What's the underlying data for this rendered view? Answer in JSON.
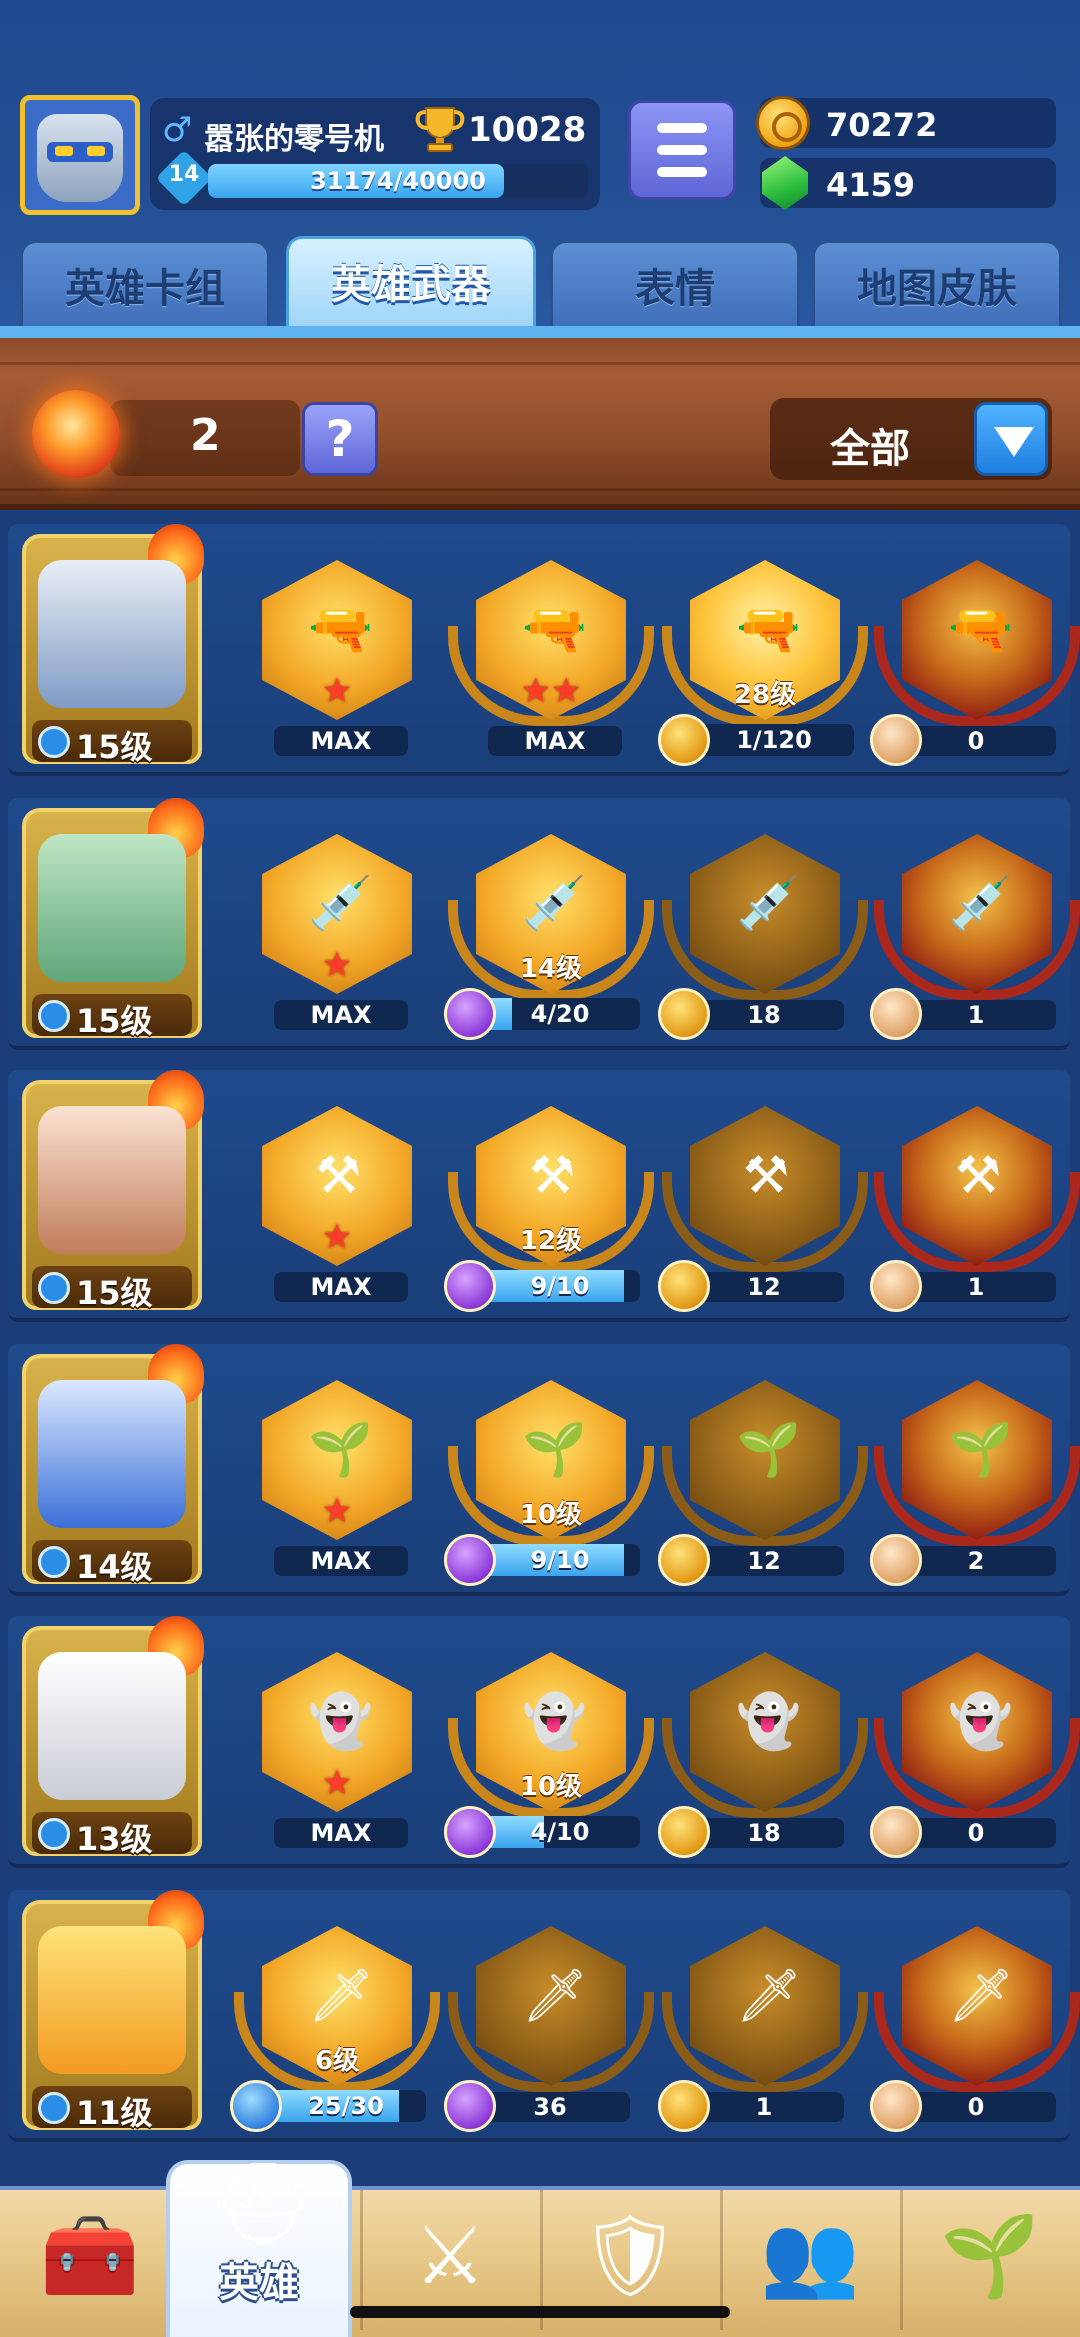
{
  "player": {
    "name": "嚣张的零号机",
    "trophies": "10028",
    "level": "14",
    "xp_text": "31174/40000",
    "xp_progress": 0.779
  },
  "currency": {
    "coins": "70272",
    "gems": "4159"
  },
  "tabs": [
    {
      "label": "英雄卡组",
      "active": false
    },
    {
      "label": "英雄武器",
      "active": true
    },
    {
      "label": "表情",
      "active": false
    },
    {
      "label": "地图皮肤",
      "active": false
    }
  ],
  "filter_bar": {
    "fireball_count": "2",
    "help_label": "?",
    "filter_value": "全部"
  },
  "heroes": [
    {
      "level": "15级",
      "class_icon": "blue-drop-icon",
      "portrait": "robot-hero",
      "slots": [
        {
          "label": "MAX",
          "stars": 1,
          "type": "max"
        },
        {
          "label": "MAX",
          "stars": 2,
          "type": "max"
        },
        {
          "level": "28级",
          "progress_text": "1/120",
          "material": "coin",
          "type": "progress-plain"
        },
        {
          "count": "0",
          "material": "hero",
          "type": "locked"
        }
      ]
    },
    {
      "level": "15级",
      "class_icon": "blue-swirl-icon",
      "portrait": "zombie-hero",
      "slots": [
        {
          "label": "MAX",
          "stars": 1,
          "type": "max"
        },
        {
          "level": "14级",
          "progress_text": "4/20",
          "progress": 0.2,
          "material": "purple",
          "type": "progress"
        },
        {
          "count": "18",
          "material": "coin",
          "type": "dim"
        },
        {
          "count": "1",
          "material": "hero",
          "type": "locked"
        }
      ]
    },
    {
      "level": "15级",
      "class_icon": "blue-butterfly-icon",
      "portrait": "girl-hero",
      "slots": [
        {
          "label": "MAX",
          "stars": 1,
          "type": "max"
        },
        {
          "level": "12级",
          "progress_text": "9/10",
          "progress": 0.9,
          "material": "purple",
          "type": "progress"
        },
        {
          "count": "12",
          "material": "coin",
          "type": "dim"
        },
        {
          "count": "1",
          "material": "hero",
          "type": "locked"
        }
      ]
    },
    {
      "level": "14级",
      "class_icon": "blue-butterfly-icon",
      "portrait": "blue-hair-hero",
      "slots": [
        {
          "label": "MAX",
          "stars": 1,
          "type": "max"
        },
        {
          "level": "10级",
          "progress_text": "9/10",
          "progress": 0.9,
          "material": "purple",
          "type": "progress"
        },
        {
          "count": "12",
          "material": "coin",
          "type": "dim"
        },
        {
          "count": "2",
          "material": "hero",
          "type": "locked"
        }
      ]
    },
    {
      "level": "13级",
      "class_icon": "blue-swirl-icon",
      "portrait": "ghost-hero",
      "slots": [
        {
          "label": "MAX",
          "stars": 1,
          "type": "max"
        },
        {
          "level": "10级",
          "progress_text": "4/10",
          "progress": 0.4,
          "material": "purple",
          "type": "progress"
        },
        {
          "count": "18",
          "material": "coin",
          "type": "dim"
        },
        {
          "count": "0",
          "material": "hero",
          "type": "locked"
        }
      ]
    },
    {
      "level": "11级",
      "class_icon": "blue-drop-icon",
      "portrait": "duck-hero",
      "slots": [
        {
          "level": "6级",
          "progress_text": "25/30",
          "progress": 0.833,
          "material": "blue",
          "type": "progress"
        },
        {
          "count": "36",
          "material": "purple",
          "type": "dim"
        },
        {
          "count": "1",
          "material": "coin",
          "type": "dim"
        },
        {
          "count": "0",
          "material": "hero",
          "type": "locked"
        }
      ]
    }
  ],
  "bottom_nav": [
    {
      "name": "treasure-chest",
      "label": ""
    },
    {
      "name": "hero",
      "label": "英雄"
    },
    {
      "name": "battle",
      "label": ""
    },
    {
      "name": "clan",
      "label": ""
    },
    {
      "name": "friends",
      "label": ""
    },
    {
      "name": "garden",
      "label": ""
    }
  ],
  "colors": {
    "background": "#1a3f7e",
    "accent_blue": "#3aa4ef",
    "star_red": "#ff3b2a",
    "gold": "#f3a726"
  }
}
